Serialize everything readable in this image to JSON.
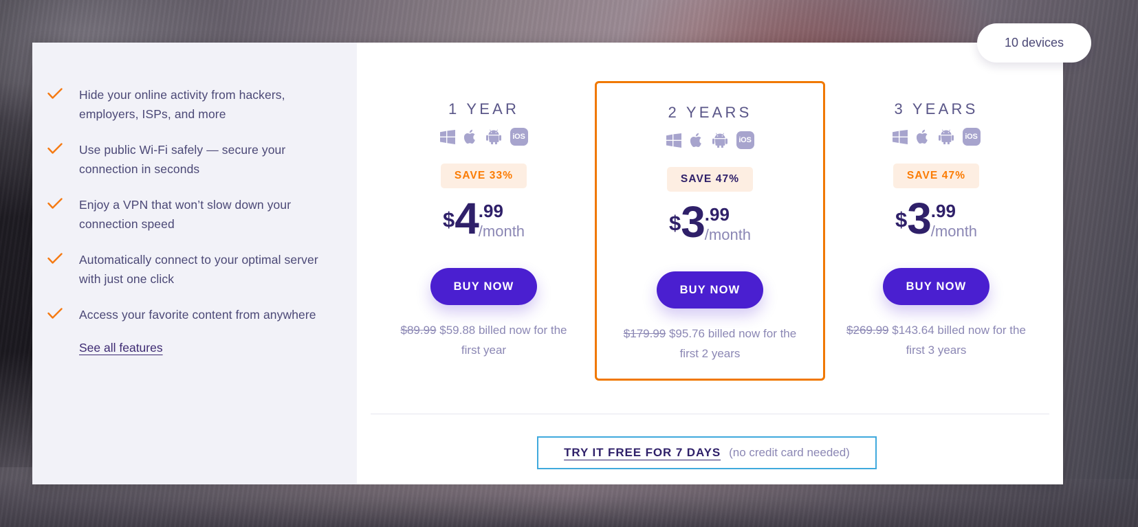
{
  "devices_pill": {
    "label": "10 devices"
  },
  "features": {
    "items": [
      {
        "check_icon": "check-icon",
        "text": "Hide your online activity from hackers, employers, ISPs, and more"
      },
      {
        "check_icon": "check-icon",
        "text": "Use public Wi-Fi safely — secure your connection in seconds"
      },
      {
        "check_icon": "check-icon",
        "text": "Enjoy a VPN that won’t slow down your connection speed"
      },
      {
        "check_icon": "check-icon",
        "text": "Automatically connect to your optimal server with just one click"
      },
      {
        "check_icon": "check-icon",
        "text": "Access your favorite content from anywhere"
      }
    ],
    "see_all_label": "See all features"
  },
  "plans": [
    {
      "title": "1 YEAR",
      "os": [
        "windows-icon",
        "apple-icon",
        "android-icon",
        "ios-icon"
      ],
      "ios_label": "iOS",
      "save_badge": "SAVE 33%",
      "currency": "$",
      "whole": "4",
      "cents": ".99",
      "per": "/month",
      "buy_label": "BUY NOW",
      "old_price": "$89.99",
      "billing_text": "$59.88 billed now for the first year",
      "featured": false
    },
    {
      "title": "2 YEARS",
      "os": [
        "windows-icon",
        "apple-icon",
        "android-icon",
        "ios-icon"
      ],
      "ios_label": "iOS",
      "save_badge": "SAVE 47%",
      "currency": "$",
      "whole": "3",
      "cents": ".99",
      "per": "/month",
      "buy_label": "BUY NOW",
      "old_price": "$179.99",
      "billing_text": "$95.76 billed now for the first 2 years",
      "featured": true
    },
    {
      "title": "3 YEARS",
      "os": [
        "windows-icon",
        "apple-icon",
        "android-icon",
        "ios-icon"
      ],
      "ios_label": "iOS",
      "save_badge": "SAVE 47%",
      "currency": "$",
      "whole": "3",
      "cents": ".99",
      "per": "/month",
      "buy_label": "BUY NOW",
      "old_price": "$269.99",
      "billing_text": "$143.64 billed now for the first 3 years",
      "featured": false
    }
  ],
  "trial": {
    "link_label": "TRY IT FREE FOR 7 DAYS",
    "note": "(no credit card needed)"
  },
  "colors": {
    "accent_purple": "#4a1fd0",
    "deep_purple": "#2f2069",
    "orange": "#fb7c04",
    "featured_border": "#f07800",
    "badge_bg": "#fdeee2",
    "trial_border": "#3fa9dd",
    "muted_text": "#8b87b4",
    "panel_left_bg": "#f2f2f8"
  }
}
